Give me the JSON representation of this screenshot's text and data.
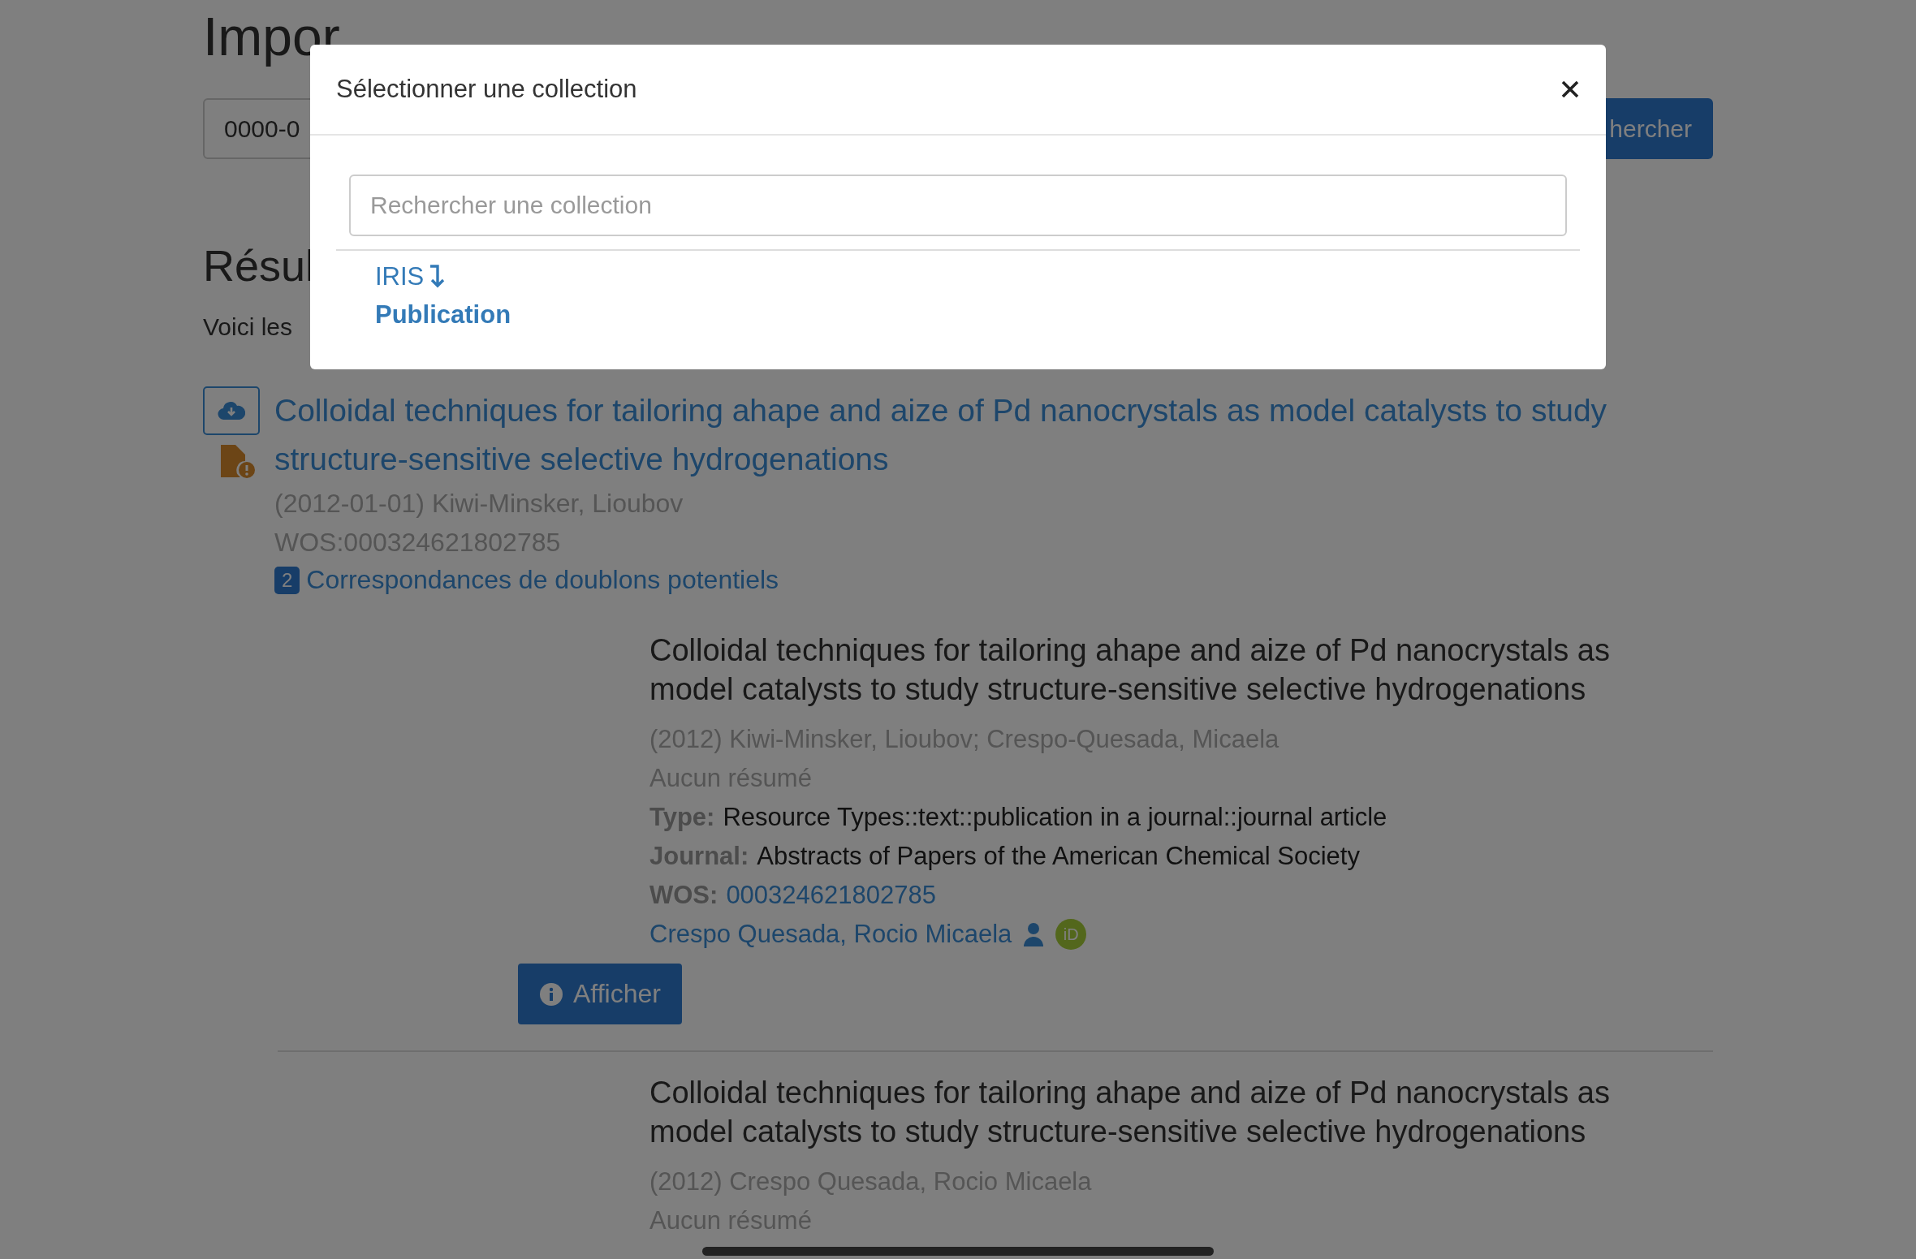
{
  "page": {
    "title": "Impor",
    "search": {
      "value": "0000-0"
    },
    "search_button": "hercher",
    "results_heading": "Résul",
    "results_intro": "Voici les"
  },
  "result": {
    "title": "Colloidal techniques for tailoring ahape and aize of Pd nanocrystals as model catalysts to study structure-sensitive selective hydrogenations",
    "meta": "(2012-01-01) Kiwi-Minsker, Lioubov",
    "identifier": "WOS:000324621802785",
    "duplicates_count": "2",
    "duplicates_link": "Correspondances de doublons potentiels",
    "duplicates": [
      {
        "title": "Colloidal techniques for tailoring ahape and aize of Pd nanocrystals as model catalysts to study structure-sensitive selective hydrogenations",
        "meta": "(2012) Kiwi-Minsker, Lioubov; Crespo-Quesada, Micaela",
        "abstract": "Aucun résumé",
        "fields": [
          {
            "label": "Type:",
            "value": "Resource Types::text::publication in a journal::journal article",
            "kind": "text"
          },
          {
            "label": "Journal:",
            "value": "Abstracts of Papers of the American Chemical Society",
            "kind": "text"
          },
          {
            "label": "WOS:",
            "value": "000324621802785",
            "kind": "link"
          }
        ],
        "author": "Crespo Quesada, Rocio Micaela",
        "orcid": "iD",
        "button": "Afficher"
      },
      {
        "title": "Colloidal techniques for tailoring ahape and aize of Pd nanocrystals as model catalysts to study structure-sensitive selective hydrogenations",
        "meta": "(2012) Crespo Quesada, Rocio Micaela",
        "abstract": "Aucun résumé"
      }
    ]
  },
  "modal": {
    "title": "Sélectionner une collection",
    "search_placeholder": "Rechercher une collection",
    "collections": [
      {
        "name": "IRIS",
        "children": [
          {
            "name": "Publication"
          }
        ]
      }
    ]
  }
}
